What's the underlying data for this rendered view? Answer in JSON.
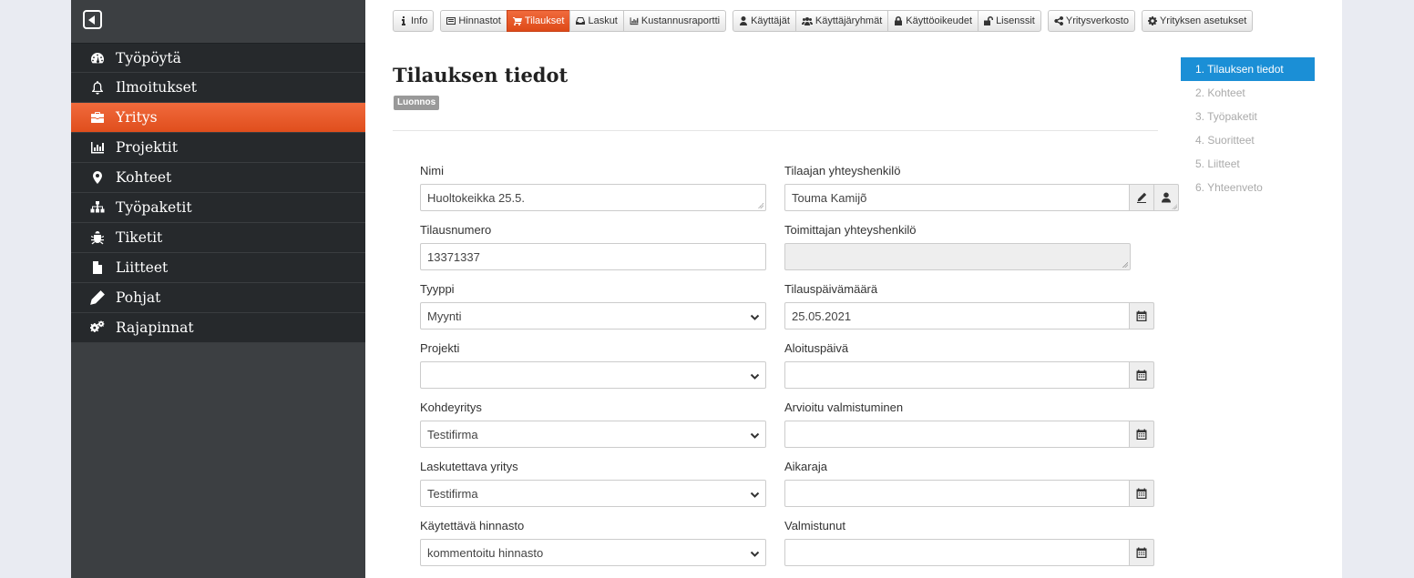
{
  "sidebar": {
    "items": [
      {
        "label": "Työpöytä",
        "icon": "dashboard-icon",
        "active": false
      },
      {
        "label": "Ilmoitukset",
        "icon": "bell-icon",
        "active": false
      },
      {
        "label": "Yritys",
        "icon": "briefcase-icon",
        "active": true
      },
      {
        "label": "Projektit",
        "icon": "bar-chart-icon",
        "active": false
      },
      {
        "label": "Kohteet",
        "icon": "map-marker-icon",
        "active": false
      },
      {
        "label": "Työpaketit",
        "icon": "sitemap-icon",
        "active": false
      },
      {
        "label": "Tiketit",
        "icon": "bug-icon",
        "active": false
      },
      {
        "label": "Liitteet",
        "icon": "file-icon",
        "active": false
      },
      {
        "label": "Pohjat",
        "icon": "pencil-icon",
        "active": false
      },
      {
        "label": "Rajapinnat",
        "icon": "cogs-icon",
        "active": false
      }
    ]
  },
  "toolbar": {
    "groups": [
      [
        {
          "label": "Info",
          "icon": "info-icon"
        }
      ],
      [
        {
          "label": "Hinnastot",
          "icon": "list-icon"
        },
        {
          "label": "Tilaukset",
          "icon": "cart-icon",
          "active": true
        },
        {
          "label": "Laskut",
          "icon": "inbox-icon"
        },
        {
          "label": "Kustannusraportti",
          "icon": "bar-chart-icon"
        }
      ],
      [
        {
          "label": "Käyttäjät",
          "icon": "user-icon"
        },
        {
          "label": "Käyttäjäryhmät",
          "icon": "users-icon"
        },
        {
          "label": "Käyttöoikeudet",
          "icon": "lock-icon"
        },
        {
          "label": "Lisenssit",
          "icon": "unlock-icon"
        }
      ],
      [
        {
          "label": "Yritysverkosto",
          "icon": "share-icon"
        }
      ],
      [
        {
          "label": "Yrityksen asetukset",
          "icon": "gear-icon"
        }
      ]
    ]
  },
  "page": {
    "title": "Tilauksen tiedot",
    "status": "Luonnos"
  },
  "form": {
    "nimi": {
      "label": "Nimi",
      "value": "Huoltokeikka 25.5."
    },
    "tilausnumero": {
      "label": "Tilausnumero",
      "value": "13371337"
    },
    "tyyppi": {
      "label": "Tyyppi",
      "value": "Myynti"
    },
    "projekti": {
      "label": "Projekti",
      "value": ""
    },
    "kohdeyritys": {
      "label": "Kohdeyritys",
      "value": "Testifirma"
    },
    "laskutettava": {
      "label": "Laskutettava yritys",
      "value": "Testifirma"
    },
    "hinnasto": {
      "label": "Käytettävä hinnasto",
      "value": "kommentoitu hinnasto"
    },
    "tilaajan_yhteys": {
      "label": "Tilaajan yhteyshenkilö",
      "value": "Touma Kamijõ"
    },
    "toimittajan_yhteys": {
      "label": "Toimittajan yhteyshenkilö",
      "value": ""
    },
    "tilauspvm": {
      "label": "Tilauspäivämäärä",
      "value": "25.05.2021"
    },
    "aloituspvm": {
      "label": "Aloituspäivä",
      "value": ""
    },
    "arvioitu": {
      "label": "Arvioitu valmistuminen",
      "value": ""
    },
    "aikaraja": {
      "label": "Aikaraja",
      "value": ""
    },
    "valmistunut": {
      "label": "Valmistunut",
      "value": ""
    }
  },
  "steps": [
    {
      "label": "1. Tilauksen tiedot",
      "active": true
    },
    {
      "label": "2. Kohteet",
      "active": false
    },
    {
      "label": "3. Työpaketit",
      "active": false
    },
    {
      "label": "4. Suoritteet",
      "active": false
    },
    {
      "label": "5. Liitteet",
      "active": false
    },
    {
      "label": "6. Yhteenveto",
      "active": false
    }
  ],
  "colors": {
    "accent": "#e8562a",
    "step_active": "#1b8fd6",
    "sidebar_bg": "#26292c"
  }
}
